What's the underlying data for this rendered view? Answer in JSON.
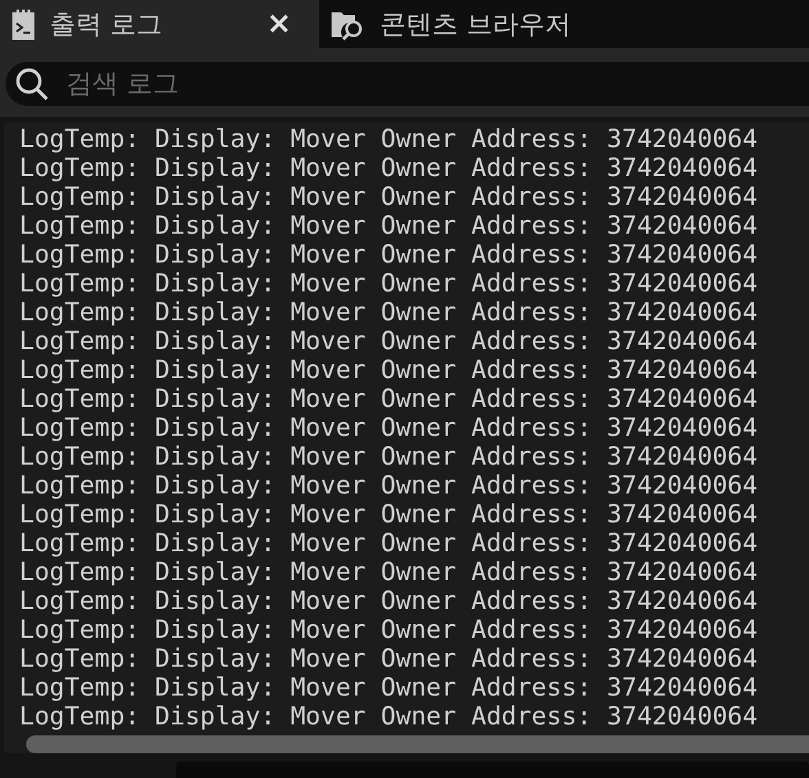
{
  "tabs": [
    {
      "label": "출력 로그",
      "selected": true,
      "closable": true,
      "close": "×",
      "kind": "terminal"
    },
    {
      "label": "콘텐츠 브라우저",
      "selected": false,
      "closable": false,
      "kind": "folder"
    }
  ],
  "search": {
    "placeholder": "검색 로그"
  },
  "log_lines": [
    "LogTemp: Display: Mover Owner Address: 3742040064",
    "LogTemp: Display: Mover Owner Address: 3742040064",
    "LogTemp: Display: Mover Owner Address: 3742040064",
    "LogTemp: Display: Mover Owner Address: 3742040064",
    "LogTemp: Display: Mover Owner Address: 3742040064",
    "LogTemp: Display: Mover Owner Address: 3742040064",
    "LogTemp: Display: Mover Owner Address: 3742040064",
    "LogTemp: Display: Mover Owner Address: 3742040064",
    "LogTemp: Display: Mover Owner Address: 3742040064",
    "LogTemp: Display: Mover Owner Address: 3742040064",
    "LogTemp: Display: Mover Owner Address: 3742040064",
    "LogTemp: Display: Mover Owner Address: 3742040064",
    "LogTemp: Display: Mover Owner Address: 3742040064",
    "LogTemp: Display: Mover Owner Address: 3742040064",
    "LogTemp: Display: Mover Owner Address: 3742040064",
    "LogTemp: Display: Mover Owner Address: 3742040064",
    "LogTemp: Display: Mover Owner Address: 3742040064",
    "LogTemp: Display: Mover Owner Address: 3742040064",
    "LogTemp: Display: Mover Owner Address: 3742040064",
    "LogTemp: Display: Mover Owner Address: 3742040064",
    "LogTemp: Display: Mover Owner Address: 3742040064"
  ]
}
